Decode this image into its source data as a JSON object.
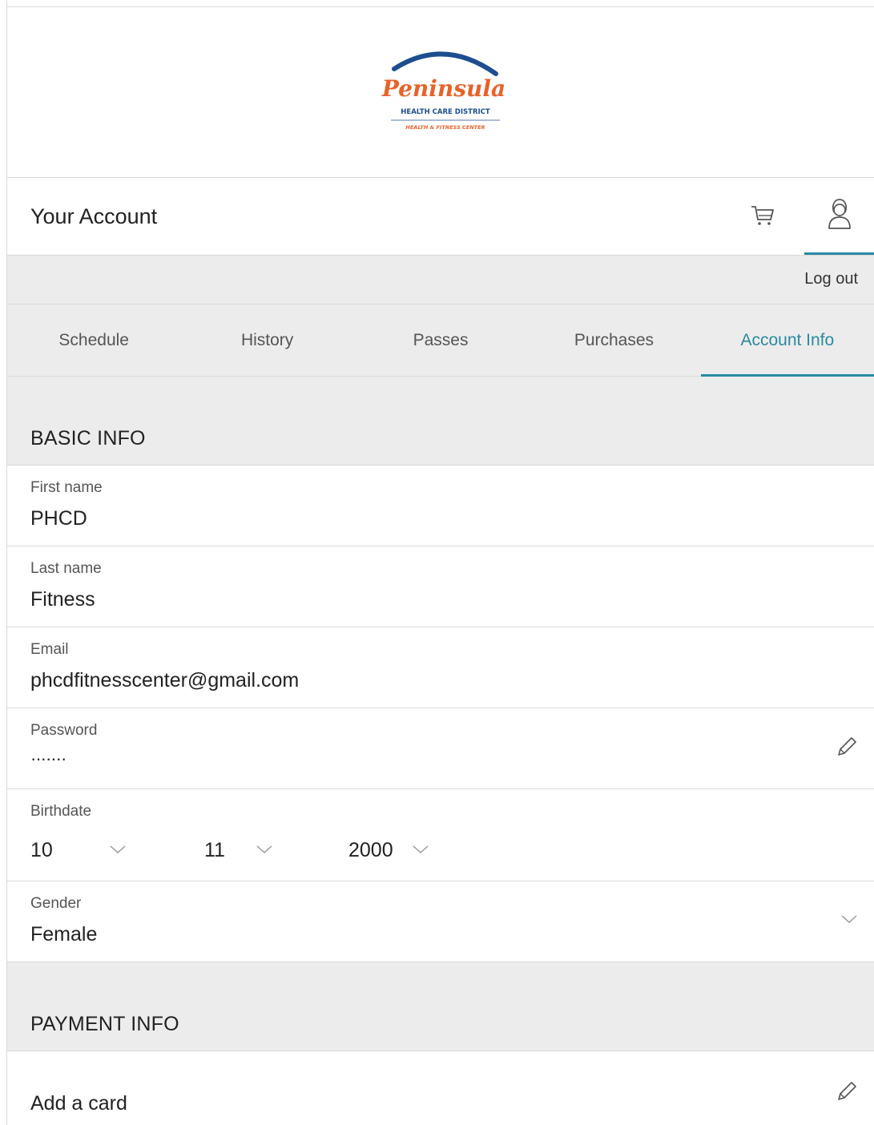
{
  "logo": {
    "brand": "Peninsula",
    "line1": "HEALTH CARE DISTRICT",
    "line2": "HEALTH & FITNESS CENTER"
  },
  "header": {
    "title": "Your Account",
    "cart_icon": "cart-icon",
    "user_icon": "user-icon"
  },
  "logout_label": "Log out",
  "tabs": [
    {
      "label": "Schedule"
    },
    {
      "label": "History"
    },
    {
      "label": "Passes"
    },
    {
      "label": "Purchases"
    },
    {
      "label": "Account Info",
      "active": true
    }
  ],
  "basic_info": {
    "title": "BASIC INFO",
    "first_name": {
      "label": "First name",
      "value": "PHCD"
    },
    "last_name": {
      "label": "Last name",
      "value": "Fitness"
    },
    "email": {
      "label": "Email",
      "value": "phcdfitnesscenter@gmail.com"
    },
    "password": {
      "label": "Password",
      "value": "·······",
      "edit_icon": "pencil-icon"
    },
    "birthdate": {
      "label": "Birthdate",
      "month": "10",
      "day": "11",
      "year": "2000"
    },
    "gender": {
      "label": "Gender",
      "value": "Female"
    }
  },
  "payment_info": {
    "title": "PAYMENT INFO",
    "add_card": "Add a card",
    "edit_icon": "pencil-icon"
  },
  "colors": {
    "accent": "#2a8aa1",
    "logo_blue": "#1d4e8f",
    "logo_orange": "#e8622a",
    "bar_bg": "#ececec",
    "divider": "#d9d9d9"
  }
}
